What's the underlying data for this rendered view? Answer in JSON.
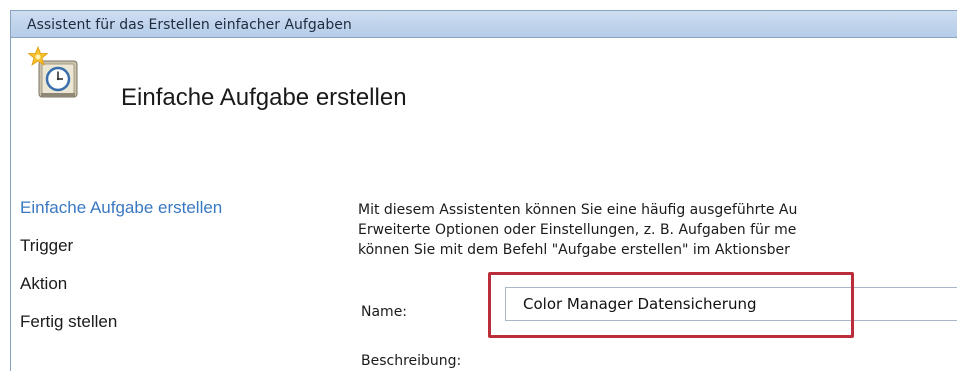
{
  "window": {
    "title": "Assistent für das Erstellen einfacher Aufgaben"
  },
  "header": {
    "icon": "task-scheduler-clock-icon",
    "title": "Einfache Aufgabe erstellen"
  },
  "steps": [
    {
      "label": "Einfache Aufgabe erstellen",
      "active": true
    },
    {
      "label": "Trigger",
      "active": false
    },
    {
      "label": "Aktion",
      "active": false
    },
    {
      "label": "Fertig stellen",
      "active": false
    }
  ],
  "description": {
    "lines": [
      "Mit diesem Assistenten können Sie eine häufig ausgeführte Au",
      "Erweiterte Optionen oder Einstellungen, z. B. Aufgaben für me",
      "können Sie mit dem Befehl \"Aufgabe erstellen\" im Aktionsber"
    ]
  },
  "form": {
    "name_label": "Name:",
    "name_value": "Color Manager Datensicherung",
    "description_label": "Beschreibung:"
  },
  "colors": {
    "accent": "#3a78c2",
    "highlight": "#bb2d3a"
  }
}
